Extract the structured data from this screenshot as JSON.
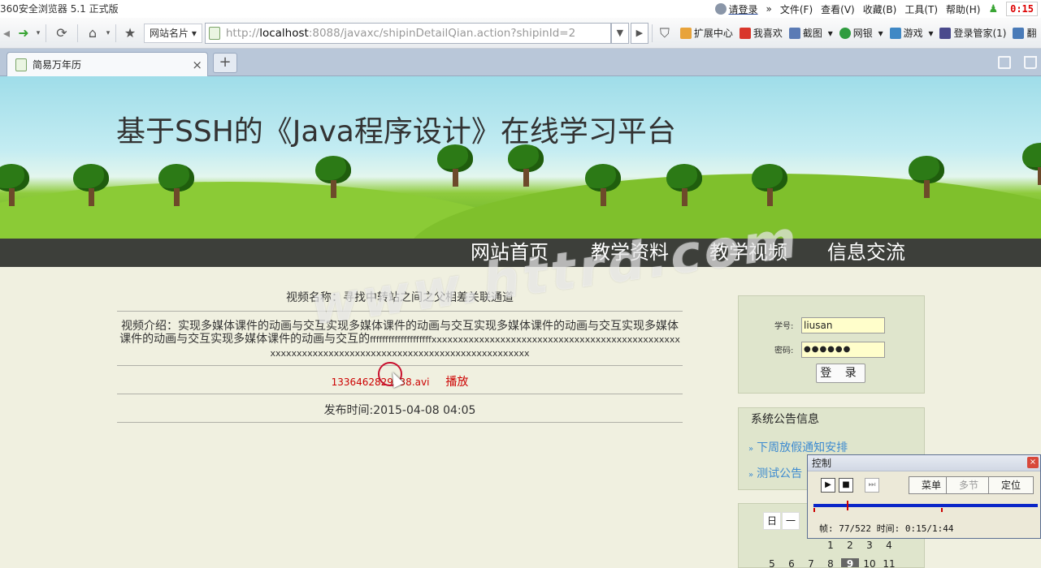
{
  "browser": {
    "app_title": "360安全浏览器 5.1 正式版",
    "menu": {
      "login": "请登录",
      "file": "文件(F)",
      "view": "查看(V)",
      "favorites": "收藏(B)",
      "tools": "工具(T)",
      "help": "帮助(H)",
      "clock": "0:15"
    },
    "site_cards": "网站名片",
    "address": {
      "prefix": "http://",
      "host": "localhost",
      "rest": ":8088/javaxc/shipinDetailQian.action?shipinId=2"
    },
    "toolbar_items": {
      "ext": "扩展中心",
      "fav": "我喜欢",
      "shot": "截图",
      "bank": "网银",
      "game": "游戏",
      "login_mgr": "登录管家(1)",
      "last": "翻"
    },
    "tab": {
      "title": "简易万年历"
    },
    "accent_colors": {
      "tab_bar": "#b9c7d9",
      "nav_bg": "#3d3f3a"
    }
  },
  "site": {
    "title": "基于SSH的《Java程序设计》在线学习平台",
    "nav": [
      "网站首页",
      "教学资料",
      "教学视频",
      "信息交流"
    ],
    "watermark": "www.httrd.com"
  },
  "video": {
    "name_label": "视频名称：",
    "name_value": "寻找中转站之间之父相差关联通道",
    "intro_label": "视频介绍：",
    "intro_text": "实现多媒体课件的动画与交互实现多媒体课件的动画与交互实现多媒体课件的动画与交互实现多媒体课件的动画与交互实现多媒体课件的动画与交互的",
    "intro_tail": "ffffffffffffffffffffxxxxxxxxxxxxxxxxxxxxxxxxxxxxxxxxxxxxxxxxxxxxxxxxxxxxxxxxxxxxxxxxxxxxxxxxxxxxxxxxxxxxxxxxxxxxxxxx",
    "file": "1336462829538.avi",
    "play": "播放",
    "publish": "发布时间:2015-04-08 04:05"
  },
  "login": {
    "id_label": "学号:",
    "id_value": "liusan",
    "pwd_label": "密码:",
    "pwd_value": "●●●●●●",
    "submit": "登 录"
  },
  "notices": {
    "header": "系统公告信息",
    "items": [
      "下周放假通知安排",
      "测试公告"
    ]
  },
  "calendar": {
    "weekdays": [
      "日",
      "一"
    ],
    "row1": [
      "1",
      "2",
      "3",
      "4"
    ],
    "row2": [
      "5",
      "6",
      "7",
      "8",
      "9",
      "10",
      "11"
    ],
    "today": "9"
  },
  "player_control": {
    "title": "控制",
    "menu_btn": "菜单",
    "multi_btn": "多节",
    "locate_btn": "定位",
    "status": "帧: 77/522 时间: 0:15/1:44",
    "frame": 77,
    "total_frames": 522,
    "progress": 0.148
  }
}
